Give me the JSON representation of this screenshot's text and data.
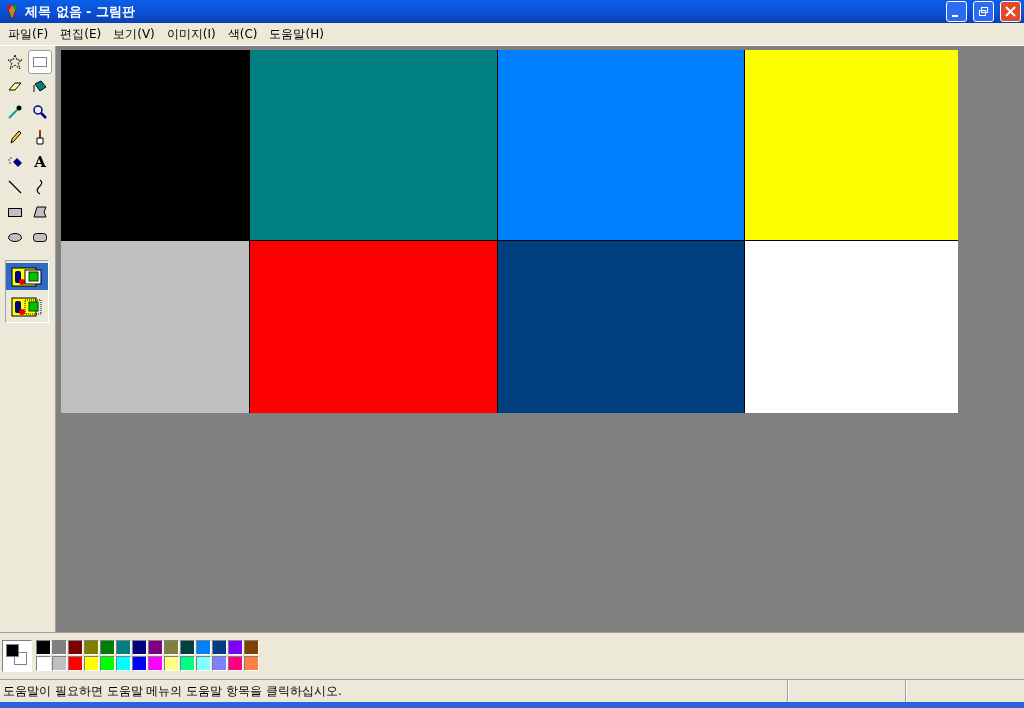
{
  "window": {
    "title": "제목 없음 - 그림판"
  },
  "menu": [
    "파일(F)",
    "편집(E)",
    "보기(V)",
    "이미지(I)",
    "색(C)",
    "도움말(H)"
  ],
  "tools": [
    {
      "kind": "free-select",
      "selected": false
    },
    {
      "kind": "select",
      "selected": true
    },
    {
      "kind": "eraser",
      "selected": false
    },
    {
      "kind": "fill",
      "selected": false
    },
    {
      "kind": "picker",
      "selected": false
    },
    {
      "kind": "magnifier",
      "selected": false
    },
    {
      "kind": "pencil",
      "selected": false
    },
    {
      "kind": "brush",
      "selected": false
    },
    {
      "kind": "airbrush",
      "selected": false
    },
    {
      "kind": "text",
      "label": "A",
      "selected": false
    },
    {
      "kind": "line",
      "selected": false
    },
    {
      "kind": "curve",
      "selected": false
    },
    {
      "kind": "rectangle",
      "selected": false
    },
    {
      "kind": "polygon",
      "selected": false
    },
    {
      "kind": "ellipse",
      "selected": false
    },
    {
      "kind": "rounded-rectangle",
      "selected": false
    }
  ],
  "tool_options": [
    {
      "kind": "opaque",
      "selected": true
    },
    {
      "kind": "transparent",
      "selected": false
    }
  ],
  "canvas": {
    "rows": [
      [
        {
          "color": "#000000"
        },
        {
          "color": "#008080"
        },
        {
          "color": "#0080ff"
        },
        {
          "color": "#ffff00"
        }
      ],
      [
        {
          "color": "#c0c0c0"
        },
        {
          "color": "#ff0000"
        },
        {
          "color": "#004080"
        },
        {
          "color": "#ffffff"
        }
      ]
    ]
  },
  "palette": {
    "current_colors": [
      {
        "color": "#000000"
      },
      {
        "color": "#ffffff"
      }
    ],
    "colors": [
      {
        "color": "#000000"
      },
      {
        "color": "#808080"
      },
      {
        "color": "#800000"
      },
      {
        "color": "#808000"
      },
      {
        "color": "#008000"
      },
      {
        "color": "#008080"
      },
      {
        "color": "#000080"
      },
      {
        "color": "#800080"
      },
      {
        "color": "#808040"
      },
      {
        "color": "#004040"
      },
      {
        "color": "#0080ff"
      },
      {
        "color": "#004080"
      },
      {
        "color": "#8000ff"
      },
      {
        "color": "#804000"
      },
      {
        "color": "#ffffff"
      },
      {
        "color": "#c0c0c0"
      },
      {
        "color": "#ff0000"
      },
      {
        "color": "#ffff00"
      },
      {
        "color": "#00ff00"
      },
      {
        "color": "#00ffff"
      },
      {
        "color": "#0000ff"
      },
      {
        "color": "#ff00ff"
      },
      {
        "color": "#ffff80"
      },
      {
        "color": "#00ff80"
      },
      {
        "color": "#80ffff"
      },
      {
        "color": "#8080ff"
      },
      {
        "color": "#ff0080"
      },
      {
        "color": "#ff8040"
      }
    ]
  },
  "status_bar": {
    "text": "도움말이 필요하면 도움말 메뉴의 도움말 항목을 클릭하십시오."
  }
}
